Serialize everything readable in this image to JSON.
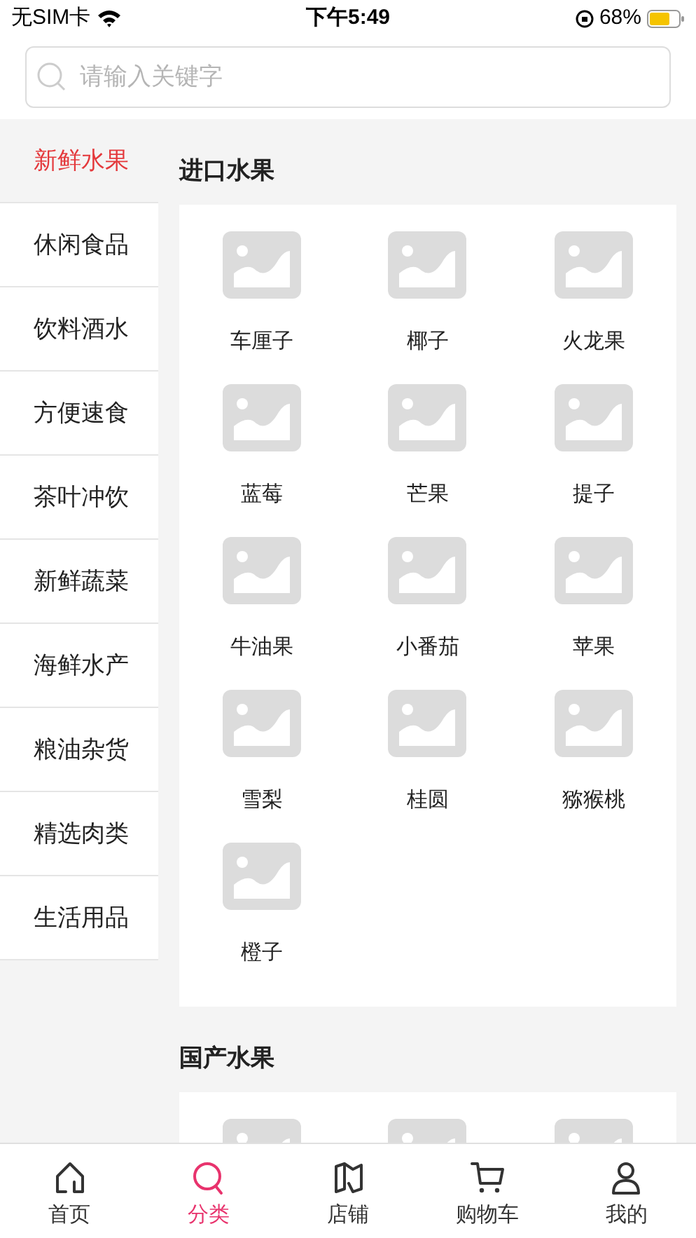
{
  "status_bar": {
    "carrier": "无SIM卡",
    "time": "下午5:49",
    "battery": "68%"
  },
  "search": {
    "placeholder": "请输入关键字"
  },
  "sidebar": {
    "items": [
      {
        "label": "新鲜水果",
        "selected": true
      },
      {
        "label": "休闲食品",
        "selected": false
      },
      {
        "label": "饮料酒水",
        "selected": false
      },
      {
        "label": "方便速食",
        "selected": false
      },
      {
        "label": "茶叶冲饮",
        "selected": false
      },
      {
        "label": "新鲜蔬菜",
        "selected": false
      },
      {
        "label": "海鲜水产",
        "selected": false
      },
      {
        "label": "粮油杂货",
        "selected": false
      },
      {
        "label": "精选肉类",
        "selected": false
      },
      {
        "label": "生活用品",
        "selected": false
      }
    ]
  },
  "sections": [
    {
      "title": "进口水果",
      "items": [
        {
          "name": "车厘子"
        },
        {
          "name": "椰子"
        },
        {
          "name": "火龙果"
        },
        {
          "name": "蓝莓"
        },
        {
          "name": "芒果"
        },
        {
          "name": "提子"
        },
        {
          "name": "牛油果"
        },
        {
          "name": "小番茄"
        },
        {
          "name": "苹果"
        },
        {
          "name": "雪梨"
        },
        {
          "name": "桂圆"
        },
        {
          "name": "猕猴桃"
        },
        {
          "name": "橙子"
        }
      ]
    },
    {
      "title": "国产水果"
    }
  ],
  "tab_bar": [
    {
      "label": "首页",
      "kind": "home",
      "selected": false
    },
    {
      "label": "分类",
      "kind": "category",
      "selected": true
    },
    {
      "label": "店铺",
      "kind": "shop",
      "selected": false
    },
    {
      "label": "购物车",
      "kind": "cart",
      "selected": false
    },
    {
      "label": "我的",
      "kind": "user",
      "selected": false
    }
  ]
}
